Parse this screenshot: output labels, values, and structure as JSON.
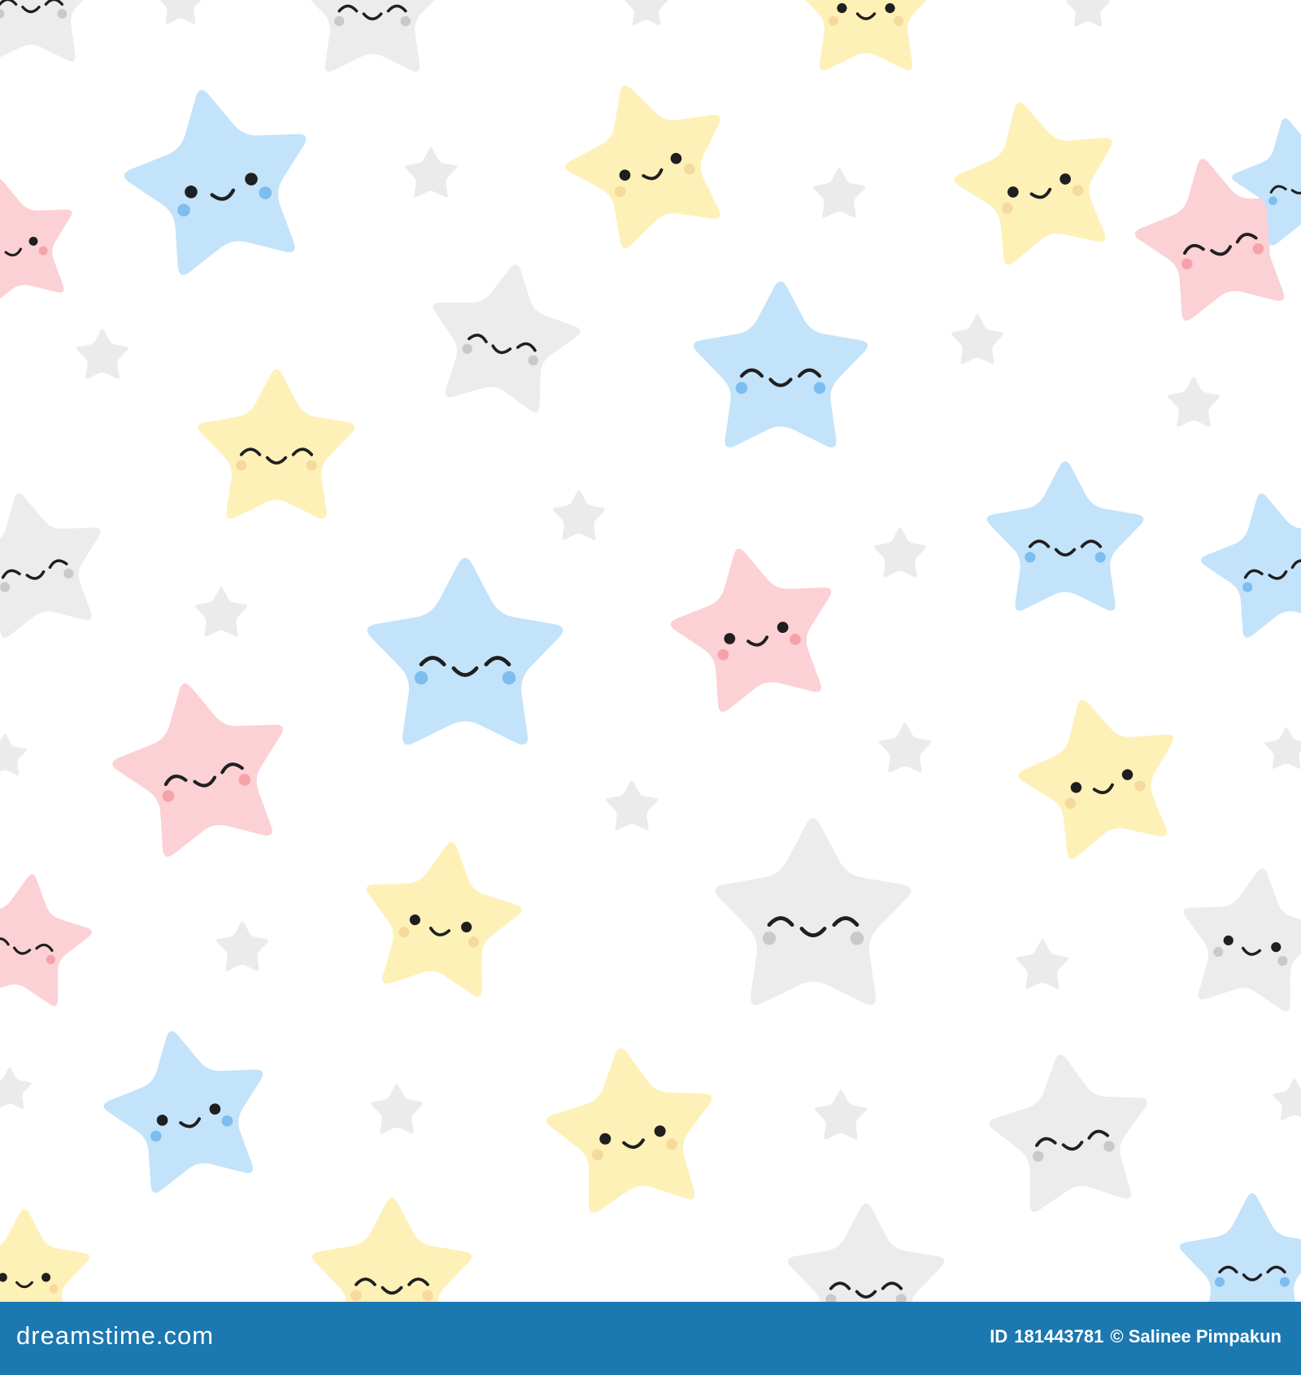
{
  "pattern": {
    "background_color": "#ffffff",
    "palette": {
      "blue": {
        "fill": "#c3e3fa",
        "blush": "#7dbdf0"
      },
      "yellow": {
        "fill": "#fdf1b8",
        "blush": "#f6d99c"
      },
      "pink": {
        "fill": "#fbd1d6",
        "blush": "#f6a2ab"
      },
      "gray": {
        "fill": "#ececec",
        "blush": "#c9c9c9"
      }
    },
    "small_star_color": "#ebebeb",
    "face_color": "#1f1f1f",
    "star_colors": [
      "blue",
      "yellow",
      "yellow",
      "pink",
      "pink",
      "gray",
      "blue",
      "yellow",
      "blue",
      "gray",
      "blue",
      "blue",
      "pink",
      "pink",
      "yellow",
      "gray",
      "pink",
      "yellow",
      "gray",
      "blue",
      "yellow",
      "gray",
      "yellow",
      "gray",
      "yellow",
      "blue",
      "blue",
      "gray",
      "gray"
    ],
    "star_expressions": [
      "open",
      "open",
      "open",
      "closed",
      "open",
      "closed",
      "closed",
      "closed",
      "closed",
      "closed",
      "closed",
      "closed",
      "open",
      "closed",
      "open",
      "closed",
      "closed",
      "open",
      "open",
      "open",
      "open",
      "closed",
      "closed",
      "closed",
      "open",
      "closed",
      "closed",
      "closed",
      "closed"
    ],
    "icons": [
      "smiling-star-icon",
      "small-star-icon"
    ]
  },
  "footer": {
    "background_color": "#1b78b0",
    "brand": "dreamstime.com",
    "id_label": "ID",
    "id_value": "181443781",
    "copyright": "© Salinee Pimpakun"
  }
}
